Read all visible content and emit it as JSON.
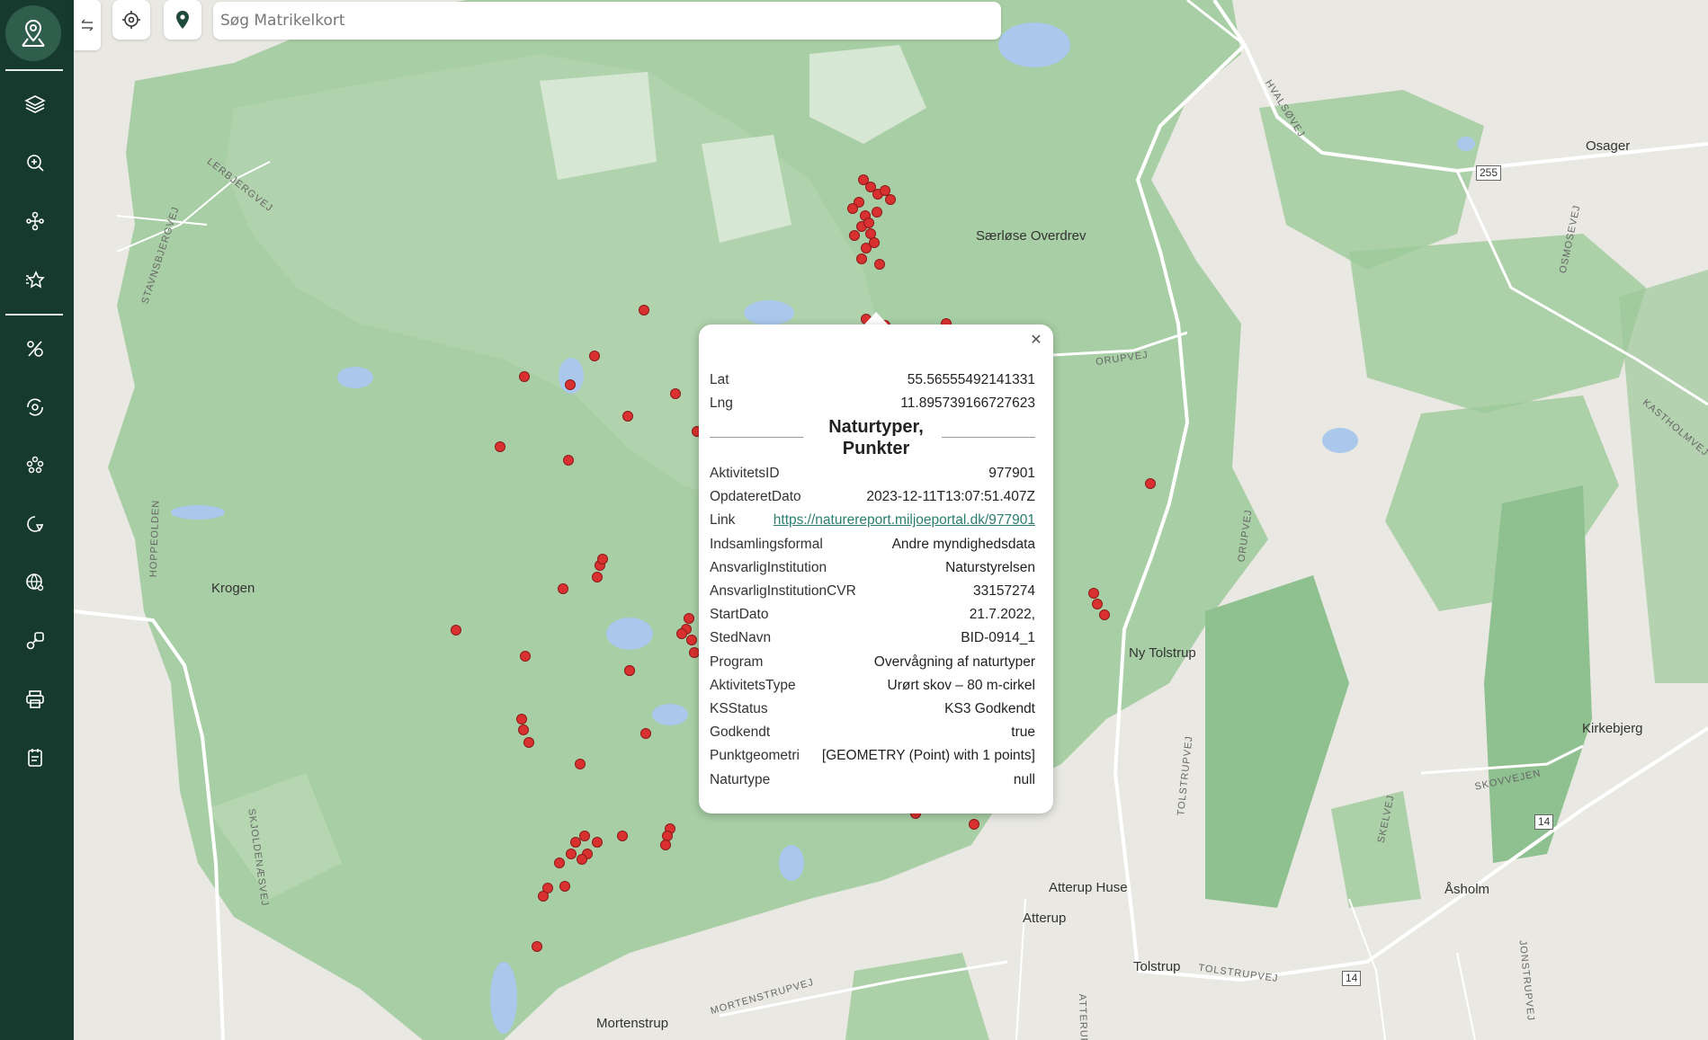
{
  "sidebar": {
    "logo": "map-pin-logo",
    "items": [
      {
        "name": "layers-icon"
      },
      {
        "name": "zoom-search-icon"
      },
      {
        "name": "route-network-icon"
      },
      {
        "name": "favorite-star-icon"
      },
      {
        "name": "percent-tag-icon"
      },
      {
        "name": "refresh-target-icon"
      },
      {
        "name": "cluster-dots-icon"
      },
      {
        "name": "location-refresh-icon"
      },
      {
        "name": "globe-search-icon"
      },
      {
        "name": "link-tools-icon"
      },
      {
        "name": "print-icon"
      },
      {
        "name": "notes-icon"
      }
    ]
  },
  "toolbar": {
    "search_placeholder": "Søg Matrikelkort"
  },
  "popup": {
    "lat_label": "Lat",
    "lat_value": "55.56555492141331",
    "lng_label": "Lng",
    "lng_value": "11.895739166727623",
    "title_line1": "Naturtyper,",
    "title_line2": "Punkter",
    "rows": [
      {
        "k": "AktivitetsID",
        "v": "977901"
      },
      {
        "k": "OpdateretDato",
        "v": "2023-12-11T13:07:51.407Z"
      },
      {
        "k": "Link",
        "v": "https://naturereport.miljoeportal.dk/977901"
      },
      {
        "k": "Indsamlingsformal",
        "v": "Andre myndighedsdata"
      },
      {
        "k": "AnsvarligInstitution",
        "v": "Naturstyrelsen"
      },
      {
        "k": "AnsvarligInstitutionCVR",
        "v": "33157274"
      },
      {
        "k": "StartDato",
        "v": "21.7.2022,"
      },
      {
        "k": "StedNavn",
        "v": "BID-0914_1"
      },
      {
        "k": "Program",
        "v": "Overvågning af naturtyper"
      },
      {
        "k": "AktivitetsType",
        "v": "Urørt skov – 80 m-cirkel"
      },
      {
        "k": "KSStatus",
        "v": "KS3 Godkendt"
      },
      {
        "k": "Godkendt",
        "v": "true"
      },
      {
        "k": "Punktgeometri",
        "v": "[GEOMETRY (Point) with 1 points]"
      },
      {
        "k": "Naturtype",
        "v": "null"
      }
    ]
  },
  "map_labels": {
    "places": [
      "Særløse Overdrev",
      "Osager",
      "Krogen",
      "Ny Tolstrup",
      "Kirkebjerg",
      "Åsholm",
      "Atterup Huse",
      "Atterup",
      "Tolstrup",
      "Mortenstrup"
    ],
    "roads": [
      "LERBJERGVEJ",
      "STAVNSBJERGVEJ",
      "HVALSØVEJ",
      "OSMOSEVEJ",
      "ORUPVEJ",
      "KASTHOLMVEJ",
      "HOPPEOLDEN",
      "ORUPVEJ",
      "TOLSTRUPVEJ",
      "SKOVVEJEN",
      "SKELVEJ",
      "SKJOLDENÆSVEJ",
      "MORTENSTRUPVEJ",
      "TOLSTRUPVEJ",
      "JONSTRUPVEJ",
      "ATTERUPVEJ"
    ],
    "shields": [
      "255",
      "14",
      "14"
    ]
  },
  "colors": {
    "sidebar": "#173a2e",
    "accent": "#2a7d6f",
    "forest": "#8fc08f",
    "marker": "#d9312f"
  }
}
